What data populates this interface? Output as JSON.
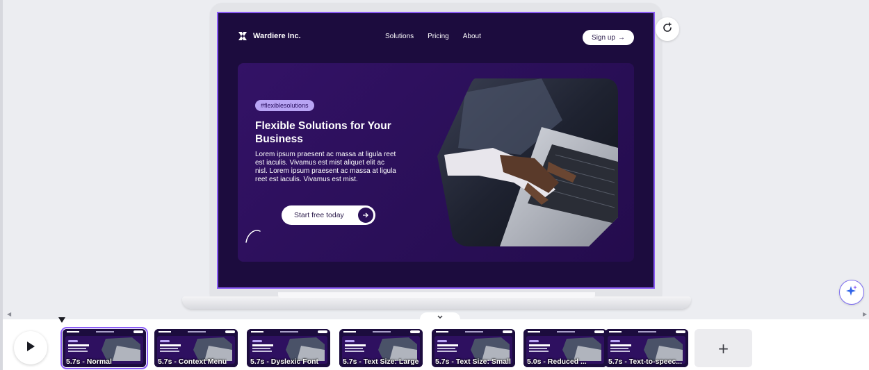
{
  "site": {
    "brand": "Wardiere Inc.",
    "nav": [
      "Solutions",
      "Pricing",
      "About"
    ],
    "signup": "Sign up",
    "signup_arrow": "→",
    "tag": "#flexiblesolutions",
    "title": "Flexible Solutions for Your Business",
    "body": "Lorem ipsum praesent ac massa at ligula reet est iaculis. Vivamus est mist aliquet elit ac nisl. Lorem ipsum praesent ac massa at ligula reet est iaculis. Vivamus est mist.",
    "cta": "Start free today",
    "cta_arrow": "→"
  },
  "timeline": {
    "clips": [
      {
        "label": "5.7s - Normal",
        "selected": true
      },
      {
        "label": "5.7s - Context Menu",
        "selected": false
      },
      {
        "label": "5.7s - Dyslexic Font",
        "selected": false
      },
      {
        "label": "5.7s - Text Size: Large",
        "selected": false
      },
      {
        "label": "5.7s - Text Size: Small",
        "selected": false
      },
      {
        "label": "5.0s - Reduced ...",
        "selected": false
      },
      {
        "label": "5.7s - Text-to-speec...",
        "selected": false
      }
    ],
    "add_label": "+"
  },
  "icons": {
    "refresh": "refresh-icon",
    "magic": "sparkle-icon",
    "play": "play-icon",
    "collapse": "chevron-down-icon"
  },
  "colors": {
    "accent": "#8b5cf6",
    "site_bg": "#1c0c3e",
    "hero_bg": "#331266",
    "tag_bg": "#b8a4f4"
  }
}
